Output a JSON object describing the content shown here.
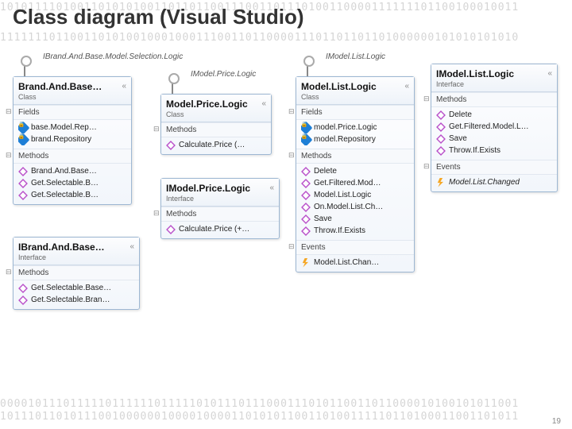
{
  "title": "Class diagram (Visual Studio)",
  "bg_top1": "10101111010011010101001101101100111001101110100110000111111101100100010011",
  "bg_top2": "11111110110011010100100010001110011011000011101101101101000000101010101010",
  "bg_bot1": "00001011101111101111110111110101110111000111010110011011000010100101011001",
  "bg_bot2": "10111011010111001000000100001000011010101100110100111110110100011001101011",
  "page_number": "19",
  "boxes": {
    "brandBase": {
      "lollipop": "IBrand.And.Base.Model.Selection.Logic",
      "name": "Brand.And.Base…",
      "stereotype": "Class",
      "collapse": "«",
      "sections": [
        {
          "title": "Fields",
          "members": [
            {
              "icon": "field-priv",
              "text": "base.Model.Rep…"
            },
            {
              "icon": "field-priv",
              "text": "brand.Repository"
            }
          ]
        },
        {
          "title": "Methods",
          "members": [
            {
              "icon": "method",
              "text": "Brand.And.Base…"
            },
            {
              "icon": "method",
              "text": "Get.Selectable.B…"
            },
            {
              "icon": "method",
              "text": "Get.Selectable.B…"
            }
          ]
        }
      ]
    },
    "iBrandBase": {
      "name": "IBrand.And.Base…",
      "stereotype": "Interface",
      "collapse": "«",
      "sections": [
        {
          "title": "Methods",
          "members": [
            {
              "icon": "method",
              "text": "Get.Selectable.Base…"
            },
            {
              "icon": "method",
              "text": "Get.Selectable.Bran…"
            }
          ]
        }
      ]
    },
    "modelPrice": {
      "lollipop": "IModel.Price.Logic",
      "name": "Model.Price.Logic",
      "stereotype": "Class",
      "collapse": "«",
      "sections": [
        {
          "title": "Methods",
          "members": [
            {
              "icon": "method",
              "text": "Calculate.Price (…"
            }
          ]
        }
      ]
    },
    "iModelPrice": {
      "name": "IModel.Price.Logic",
      "stereotype": "Interface",
      "collapse": "«",
      "sections": [
        {
          "title": "Methods",
          "members": [
            {
              "icon": "method",
              "text": "Calculate.Price (+…"
            }
          ]
        }
      ]
    },
    "modelList": {
      "lollipop": "IModel.List.Logic",
      "name": "Model.List.Logic",
      "stereotype": "Class",
      "collapse": "«",
      "sections": [
        {
          "title": "Fields",
          "members": [
            {
              "icon": "field-priv",
              "text": "model.Price.Logic"
            },
            {
              "icon": "field-priv",
              "text": "model.Repository"
            }
          ]
        },
        {
          "title": "Methods",
          "members": [
            {
              "icon": "method",
              "text": "Delete"
            },
            {
              "icon": "method",
              "text": "Get.Filtered.Mod…"
            },
            {
              "icon": "method",
              "text": "Model.List.Logic"
            },
            {
              "icon": "method-priv",
              "text": "On.Model.List.Ch…"
            },
            {
              "icon": "method",
              "text": "Save"
            },
            {
              "icon": "method",
              "text": "Throw.If.Exists"
            }
          ]
        },
        {
          "title": "Events",
          "members": [
            {
              "icon": "event",
              "text": "Model.List.Chan…"
            }
          ]
        }
      ]
    },
    "iModelList": {
      "name": "IModel.List.Logic",
      "stereotype": "Interface",
      "collapse": "«",
      "sections": [
        {
          "title": "Methods",
          "members": [
            {
              "icon": "method",
              "text": "Delete"
            },
            {
              "icon": "method",
              "text": "Get.Filtered.Model.L…"
            },
            {
              "icon": "method",
              "text": "Save"
            },
            {
              "icon": "method",
              "text": "Throw.If.Exists"
            }
          ]
        },
        {
          "title": "Events",
          "members": [
            {
              "icon": "event",
              "text": "Model.List.Changed"
            }
          ]
        }
      ]
    }
  }
}
